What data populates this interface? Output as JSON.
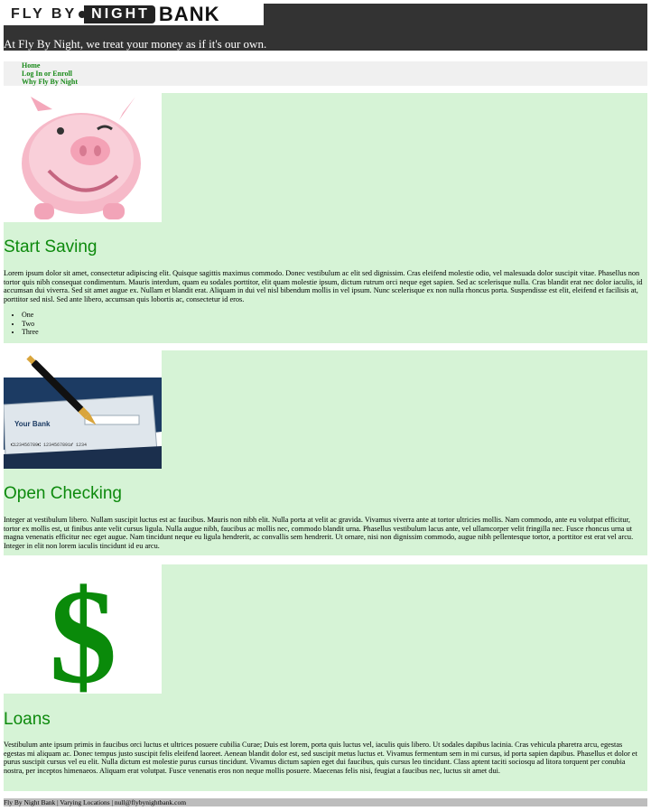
{
  "header": {
    "logo": {
      "part1": "FLY BY",
      "part2": "NIGHT",
      "part3": "BANK"
    },
    "tagline": "At Fly By Night, we treat your money as if it's our own."
  },
  "nav": {
    "items": [
      {
        "label": "Home"
      },
      {
        "label": "Log In or Enroll"
      },
      {
        "label": "Why Fly By Night"
      }
    ]
  },
  "sections": [
    {
      "image": "piggy-bank-image",
      "title": "Start Saving",
      "body": "Lorem ipsum dolor sit amet, consectetur adipiscing elit. Quisque sagittis maximus commodo. Donec vestibulum ac elit sed dignissim. Cras eleifend molestie odio, vel malesuada dolor suscipit vitae. Phasellus non tortor quis nibh consequat condimentum. Mauris interdum, quam eu sodales porttitor, elit quam molestie ipsum, dictum rutrum orci neque eget sapien. Sed ac scelerisque nulla. Cras blandit erat nec dolor iaculis, id accumsan dui viverra. Sed sit amet augue ex. Nullam et blandit erat. Aliquam in dui vel nisl bibendum mollis in vel ipsum. Nunc scelerisque ex non nulla rhoncus porta. Suspendisse est elit, eleifend et facilisis at, porttitor sed nisl. Sed ante libero, accumsan quis lobortis ac, consectetur id eros.",
      "list": [
        "One",
        "Two",
        "Three"
      ]
    },
    {
      "image": "check-and-pen-image",
      "image_text": {
        "bank": "Your Bank",
        "micr": "⑆123456789⑆ 1234567891⑈ 1234"
      },
      "title": "Open Checking",
      "body": "Integer at vestibulum libero. Nullam suscipit luctus est ac faucibus. Mauris non nibh elit. Nulla porta at velit ac gravida. Vivamus viverra ante at tortor ultricies mollis. Nam commodo, ante eu volutpat efficitur, tortor ex mollis est, ut finibus ante velit cursus ligula. Nulla augue nibh, faucibus ac mollis nec, commodo blandit urna. Phasellus vestibulum lacus ante, vel ullamcorper velit fringilla nec. Fusce rhoncus urna ut magna venenatis efficitur nec eget augue. Nam tincidunt neque eu ligula hendrerit, ac convallis sem hendrerit. Ut ornare, nisi non dignissim commodo, augue nibh pellentesque tortor, a porttitor est erat vel arcu. Integer in elit non lorem iaculis tincidunt id eu arcu."
    },
    {
      "image": "dollar-sign-image",
      "title": "Loans",
      "body": "Vestibulum ante ipsum primis in faucibus orci luctus et ultrices posuere cubilia Curae; Duis est lorem, porta quis luctus vel, iaculis quis libero. Ut sodales dapibus lacinia. Cras vehicula pharetra arcu, egestas egestas mi aliquam ac. Donec tempus justo suscipit felis eleifend laoreet. Aenean blandit dolor est, sed suscipit metus luctus et. Vivamus fermentum sem in mi cursus, id porta sapien dapibus. Phasellus et dolor et purus suscipit cursus vel eu elit. Nulla dictum est molestie purus cursus tincidunt. Vivamus dictum sapien eget dui faucibus, quis cursus leo tincidunt. Class aptent taciti sociosqu ad litora torquent per conubia nostra, per inceptos himenaeos. Aliquam erat volutpat. Fusce venenatis eros non neque mollis posuere. Maecenas felis nisi, feugiat a faucibus nec, luctus sit amet dui."
    }
  ],
  "footer": {
    "text": "Fly By Night Bank | Varying Locations | null@flybynightbank.com"
  },
  "colors": {
    "header_bg": "#333333",
    "section_bg": "#d6f3d6",
    "heading_green": "#0d8a0d",
    "nav_bg": "#f0f0f0",
    "footer_bg": "#bdbdbd"
  }
}
